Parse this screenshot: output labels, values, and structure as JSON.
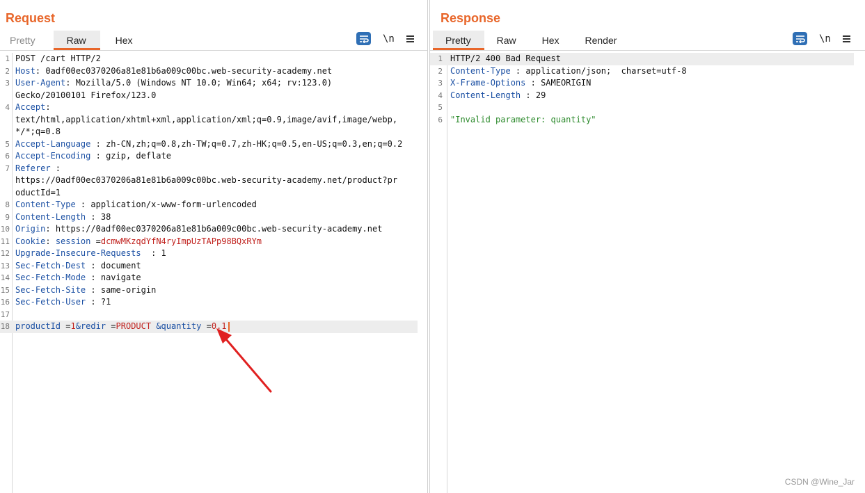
{
  "layout_toggle": {
    "active": "side-by-side"
  },
  "request": {
    "title": "Request",
    "tabs": [
      "Pretty",
      "Raw",
      "Hex"
    ],
    "active_tab": "Raw",
    "newline_label": "\\n",
    "lines": [
      {
        "n": "1",
        "text": "POST /cart HTTP/2"
      },
      {
        "n": "2",
        "name": "Host",
        "sep": ": ",
        "value": "0adf00ec0370206a81e81b6a009c00bc.web-security-academy.net"
      },
      {
        "n": "3",
        "name": "User-Agent",
        "sep": ": ",
        "value": "Mozilla/5.0 (Windows NT 10.0; Win64; x64; rv:123.0)",
        "cont": [
          "Gecko/20100101 Firefox/123.0"
        ]
      },
      {
        "n": "4",
        "name": "Accept",
        "sep": ":",
        "value": "",
        "cont": [
          "text/html,application/xhtml+xml,application/xml;q=0.9,image/avif,image/webp,",
          "*/*;q=0.8"
        ]
      },
      {
        "n": "5",
        "name": "Accept-Language",
        "sep": " : ",
        "value": "zh-CN,zh;q=0.8,zh-TW;q=0.7,zh-HK;q=0.5,en-US;q=0.3,en;q=0.2"
      },
      {
        "n": "6",
        "name": "Accept-Encoding",
        "sep": " : ",
        "value": "gzip, deflate"
      },
      {
        "n": "7",
        "name": "Referer",
        "sep": " :",
        "value": "",
        "cont": [
          "https://0adf00ec0370206a81e81b6a009c00bc.web-security-academy.net/product?pr",
          "oductId=1"
        ]
      },
      {
        "n": "8",
        "name": "Content-Type",
        "sep": " : ",
        "value": "application/x-www-form-urlencoded"
      },
      {
        "n": "9",
        "name": "Content-Length",
        "sep": " : ",
        "value": "38"
      },
      {
        "n": "10",
        "name": "Origin",
        "sep": ": ",
        "value": "https://0adf00ec0370206a81e81b6a009c00bc.web-security-academy.net"
      },
      {
        "n": "11",
        "name": "Cookie",
        "sep": ": ",
        "cookie_name": "session",
        "cookie_eq": " =",
        "cookie_value": "dcmwMKzqdYfN4ryImpUzTAPp98BQxRYm"
      },
      {
        "n": "12",
        "name": "Upgrade-Insecure-Requests",
        "sep": "  : ",
        "value": "1"
      },
      {
        "n": "13",
        "name": "Sec-Fetch-Dest",
        "sep": " : ",
        "value": "document"
      },
      {
        "n": "14",
        "name": "Sec-Fetch-Mode",
        "sep": " : ",
        "value": "navigate"
      },
      {
        "n": "15",
        "name": "Sec-Fetch-Site",
        "sep": " : ",
        "value": "same-origin"
      },
      {
        "n": "16",
        "name": "Sec-Fetch-User",
        "sep": " : ",
        "value": "?1"
      },
      {
        "n": "17",
        "text": ""
      },
      {
        "n": "18",
        "body": [
          {
            "t": "productId",
            "c": "hn"
          },
          {
            "t": " =",
            "c": ""
          },
          {
            "t": "1",
            "c": "red"
          },
          {
            "t": "&redir",
            "c": "hn"
          },
          {
            "t": " =",
            "c": ""
          },
          {
            "t": "PRODUCT",
            "c": "red"
          },
          {
            "t": " &quantity",
            "c": "hn"
          },
          {
            "t": " =",
            "c": ""
          },
          {
            "t": "0.1",
            "c": "red"
          }
        ],
        "highlight": true
      }
    ]
  },
  "response": {
    "title": "Response",
    "tabs": [
      "Pretty",
      "Raw",
      "Hex",
      "Render"
    ],
    "active_tab": "Pretty",
    "newline_label": "\\n",
    "lines": [
      {
        "n": "1",
        "text": "HTTP/2 400 Bad Request",
        "highlight": true
      },
      {
        "n": "2",
        "name": "Content-Type",
        "sep": " : ",
        "value": "application/json;  charset=utf-8"
      },
      {
        "n": "3",
        "name": "X-Frame-Options",
        "sep": " : ",
        "value": "SAMEORIGIN"
      },
      {
        "n": "4",
        "name": "Content-Length",
        "sep": " : ",
        "value": "29"
      },
      {
        "n": "5",
        "text": ""
      },
      {
        "n": "6",
        "string": "\"Invalid parameter: quantity\""
      }
    ]
  },
  "watermark": "CSDN @Wine_Jar",
  "colors": {
    "accent": "#e8662a",
    "header_name": "#1a4fa3",
    "param_value": "#c0211d",
    "json_string": "#2c8a2c",
    "button_blue": "#2f6fb5"
  }
}
